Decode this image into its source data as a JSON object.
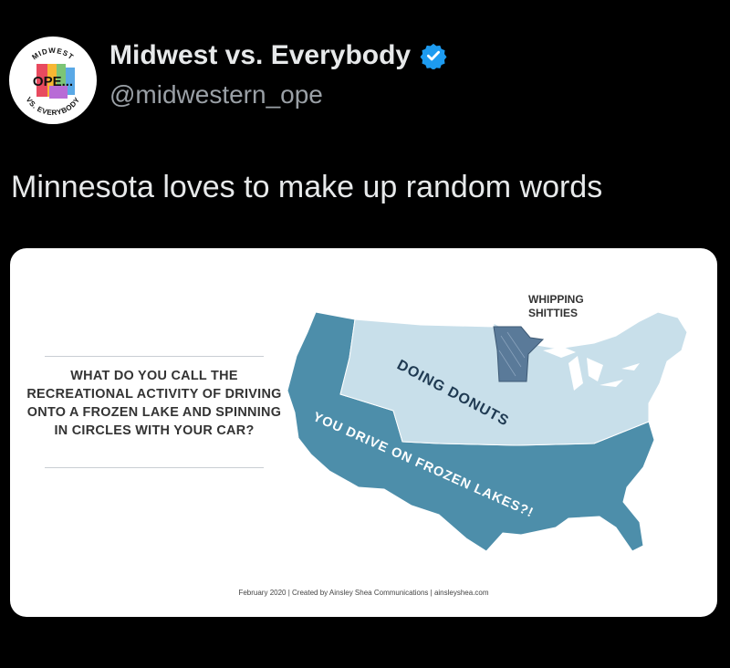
{
  "account": {
    "display_name": "Midwest vs. Everybody",
    "handle": "@midwestern_ope",
    "avatar": {
      "top_text": "MIDWEST",
      "center_text": "OPE...",
      "bottom_text": "VS. EVERYBODY"
    }
  },
  "tweet": {
    "text": "Minnesota loves to make up random words"
  },
  "infographic": {
    "question": "WHAT DO YOU CALL THE RECREATIONAL ACTIVITY OF DRIVING ONTO A FROZEN LAKE AND SPINNING IN CIRCLES WITH YOUR CAR?",
    "region_labels": {
      "minnesota_line1": "WHIPPING",
      "minnesota_line2": "SHITTIES",
      "northern": "DOING DONUTS",
      "southern": "YOU DRIVE ON FROZEN LAKES?!"
    },
    "credit": "February 2020 | Created by Ainsley Shea Communications | ainsleyshea.com",
    "colors": {
      "dark_region": "#4d8eaa",
      "light_region": "#c8dfea",
      "minnesota": "#5a7a99"
    }
  }
}
